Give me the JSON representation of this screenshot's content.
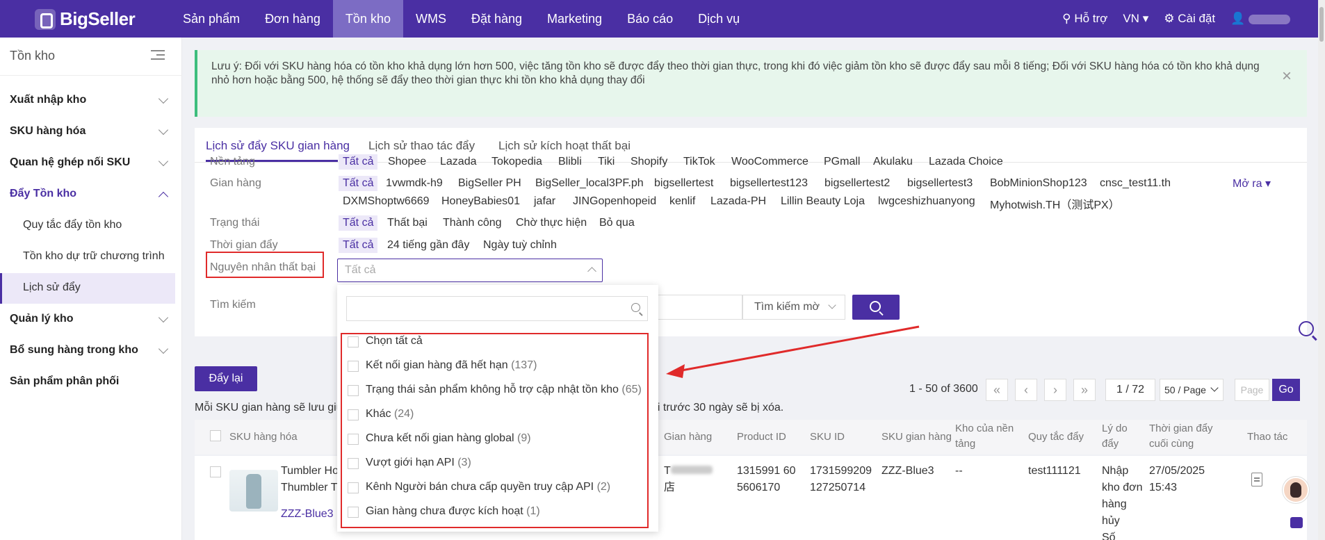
{
  "colors": {
    "brand": "#4a2fa3",
    "alert": "#e02a2a",
    "notice_bg": "#e7f6ec"
  },
  "app": {
    "logo": "BigSeller"
  },
  "nav": {
    "items": [
      "Sản phẩm",
      "Đơn hàng",
      "Tồn kho",
      "WMS",
      "Đặt hàng",
      "Marketing",
      "Báo cáo",
      "Dịch vụ"
    ],
    "active_index": 2,
    "support": "Hỗ trợ",
    "lang": "VN",
    "settings": "Cài đặt"
  },
  "sidebar": {
    "title": "Tồn kho",
    "groups": [
      {
        "label": "Xuất nhập kho"
      },
      {
        "label": "SKU hàng hóa"
      },
      {
        "label": "Quan hệ ghép nối SKU"
      },
      {
        "label": "Đẩy Tồn kho"
      },
      {
        "label": "Quản lý kho"
      },
      {
        "label": "Bổ sung hàng trong kho"
      },
      {
        "label": "Sản phẩm phân phối"
      }
    ],
    "subitems": [
      "Quy tắc đẩy tồn kho",
      "Tồn kho dự trữ chương trình",
      "Lịch sử đẩy"
    ],
    "active_sub": "Lịch sử đẩy"
  },
  "notice": {
    "text": "Lưu ý: Đối với SKU hàng hóa có tồn kho khả dụng lớn hơn 500, việc tăng tồn kho sẽ được đẩy theo thời gian thực, trong khi đó việc giảm tồn kho sẽ được đẩy sau mỗi 8 tiếng; Đối với SKU hàng hóa có tồn kho khả dụng nhỏ hơn hoặc bằng 500, hệ thống sẽ đẩy theo thời gian thực khi tồn kho khả dụng thay đổi",
    "close": "×"
  },
  "tabs": [
    "Lịch sử đẩy SKU gian hàng",
    "Lịch sử thao tác đẩy",
    "Lịch sử kích hoạt thất bại"
  ],
  "filters": {
    "platform": {
      "label": "Nền tảng",
      "options": [
        "Tất cả",
        "Shopee",
        "Lazada",
        "Tokopedia",
        "Blibli",
        "Tiki",
        "Shopify",
        "TikTok",
        "WooCommerce",
        "PGmall",
        "Akulaku",
        "Lazada Choice"
      ]
    },
    "store": {
      "label": "Gian hàng",
      "options_row1": [
        "Tất cả",
        "1vwmdk-h9",
        "BigSeller PH",
        "BigSeller_local3PF.ph",
        "bigsellertest",
        "bigsellertest123",
        "bigsellertest2",
        "bigsellertest3",
        "BobMinionShop123",
        "cnsc_test11.th"
      ],
      "options_row2": [
        "DXMShoptw6669",
        "HoneyBabies01",
        "jafar",
        "JINGopenhopeid",
        "kenlif",
        "Lazada-PH",
        "Lillin Beauty Loja",
        "lwgceshizhuanyong",
        "Myhotwish.TH（测试PX）"
      ],
      "more": "Mở ra"
    },
    "status": {
      "label": "Trạng thái",
      "options": [
        "Tất cả",
        "Thất bại",
        "Thành công",
        "Chờ thực hiện",
        "Bỏ qua"
      ]
    },
    "push_time": {
      "label": "Thời gian đẩy",
      "options": [
        "Tất cả",
        "24 tiếng gần đây",
        "Ngày tuỳ chỉnh"
      ]
    },
    "fail_reason": {
      "label": "Nguyên nhân thất bại",
      "placeholder": "Tất cả"
    },
    "search": {
      "label": "Tìm kiếm",
      "mode": "Tìm kiếm mờ"
    }
  },
  "dropdown": {
    "items": [
      {
        "label": "Chọn tất cả",
        "count": ""
      },
      {
        "label": "Kết nối gian hàng đã hết hạn",
        "count": "(137)"
      },
      {
        "label": "Trạng thái sản phẩm không hỗ trợ cập nhật tồn kho",
        "count": "(65)"
      },
      {
        "label": "Khác",
        "count": "(24)"
      },
      {
        "label": "Chưa kết nối gian hàng global",
        "count": "(9)"
      },
      {
        "label": "Vượt giới hạn API",
        "count": "(3)"
      },
      {
        "label": "Kênh Người bán chưa cấp quyền truy cập API",
        "count": "(2)"
      },
      {
        "label": "Gian hàng chưa được kích hoạt",
        "count": "(1)"
      }
    ]
  },
  "actions": {
    "redo": "Đẩy lại"
  },
  "info": {
    "prefix": "Mỗi SKU gian hàng sẽ lưu giữ",
    "suffix": "hi trước 30 ngày sẽ bị xóa."
  },
  "pager": {
    "count": "1 - 50 of 3600",
    "page": "1 / 72",
    "size": "50 / Page",
    "page_placeholder": "Page",
    "go": "Go",
    "first": "«",
    "prev": "‹",
    "next": "›",
    "last": "»"
  },
  "table": {
    "headers": [
      "SKU hàng hóa",
      "Gian hàng",
      "Product ID",
      "SKU ID",
      "SKU gian hàng",
      "Kho của nền tảng",
      "Quy tắc đẩy",
      "Lý do đẩy",
      "Thời gian đẩy cuối cùng",
      "Thao tác"
    ],
    "row": {
      "title_line1": "Tumbler Ho",
      "title_line2": "Thumbler T",
      "sku": "ZZZ-Blue3",
      "store_prefix": "T",
      "store_line2": "店",
      "product_id_line1": "1315991 60",
      "product_id_line2": "5606170",
      "sku_id_line1": "1731599209",
      "sku_id_line2": "127250714",
      "store_sku": "ZZZ-Blue3",
      "platform_wh": "--",
      "rule": "test111121",
      "reason": [
        "Nhập",
        "kho đơn",
        "hàng",
        "hủy",
        "Số"
      ],
      "time_date": "27/05/2025",
      "time_clock": "15:43"
    }
  }
}
